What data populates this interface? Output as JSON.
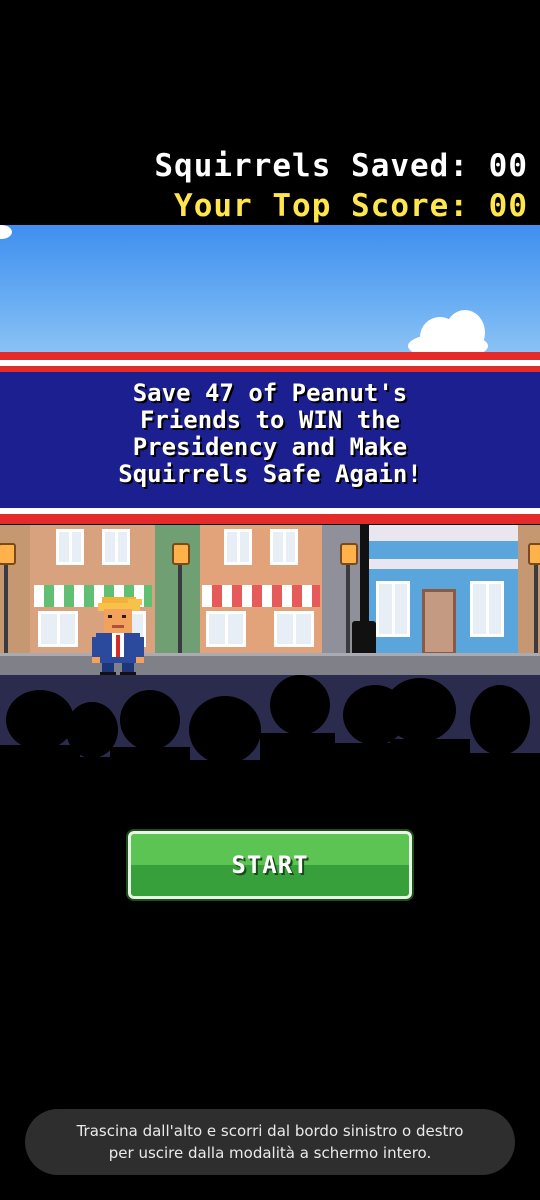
{
  "hud": {
    "squirrels_saved_label": "Squirrels Saved: 00",
    "top_score_label": "Your Top Score: 00"
  },
  "banner": {
    "line1": "Save 47 of Peanut's",
    "line2": "Friends to WIN the",
    "line3": "Presidency and Make",
    "line4": "Squirrels Safe Again!"
  },
  "start_button": {
    "label": "START"
  },
  "toast": {
    "line1": "Trascina dall'alto e scorri dal bordo sinistro o destro",
    "line2": "per uscire dalla modalità a schermo intero."
  },
  "colors": {
    "background": "#000000",
    "score_white": "#ffffff",
    "score_yellow": "#ffe64d",
    "banner_blue": "#1c1f8f",
    "banner_red": "#e52a2a",
    "sky": "#4a97f0",
    "button_green": "#4bb545",
    "crowd_bg": "#2b2b4d",
    "toast_bg": "#2e2e2e"
  }
}
